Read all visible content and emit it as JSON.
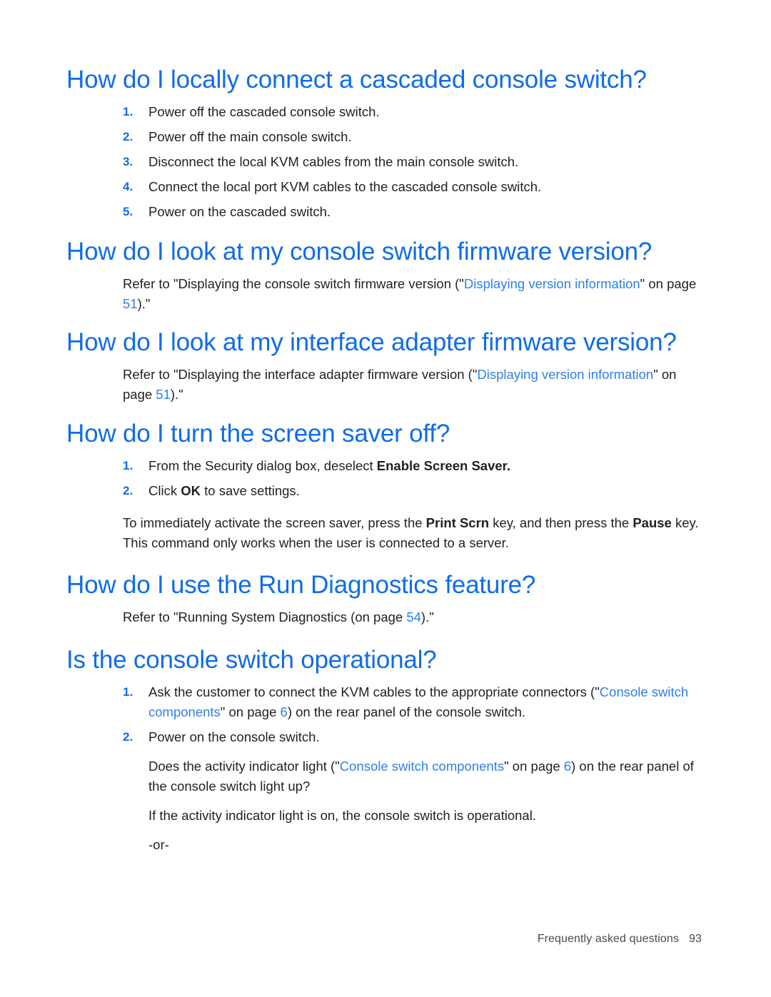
{
  "document": {
    "accent_color": "#0f6ce8",
    "link_color": "#2f7fe8",
    "text_color": "#231f20"
  },
  "sections": [
    {
      "heading": "How do I locally connect a cascaded console switch?",
      "steps": [
        {
          "num": "1.",
          "text": "Power off the cascaded console switch."
        },
        {
          "num": "2.",
          "text": "Power off the main console switch."
        },
        {
          "num": "3.",
          "text": "Disconnect the local KVM cables from the main console switch."
        },
        {
          "num": "4.",
          "text": "Connect the local port KVM cables to the cascaded console switch."
        },
        {
          "num": "5.",
          "text": "Power on the cascaded switch."
        }
      ]
    },
    {
      "heading": "How do I look at my console switch firmware version?",
      "paragraph": {
        "pre": "Refer to \"Displaying the console switch firmware version (\"",
        "link": "Displaying version information",
        "mid": "\" on page ",
        "page": "51",
        "post": ").\""
      }
    },
    {
      "heading": "How do I look at my interface adapter firmware version?",
      "paragraph": {
        "pre": "Refer to \"Displaying the interface adapter firmware version (\"",
        "link": "Displaying version information",
        "mid": "\" on page ",
        "page": "51",
        "post": ").\""
      }
    },
    {
      "heading": "How do I turn the screen saver off?",
      "steps": [
        {
          "num": "1.",
          "pre": "From the Security dialog box, deselect ",
          "bold": "Enable Screen Saver.",
          "post": ""
        },
        {
          "num": "2.",
          "pre": "Click ",
          "bold": "OK",
          "post": " to save settings."
        }
      ],
      "note": {
        "pre": "To immediately activate the screen saver, press the ",
        "bold1": "Print Scrn",
        "mid": " key, and then press the ",
        "bold2": "Pause",
        "post": " key. This command only works when the user is connected to a server."
      }
    },
    {
      "heading": "How do I use the Run Diagnostics feature?",
      "paragraph": {
        "pre": "Refer to \"Running System Diagnostics (on page ",
        "page": "54",
        "post": ").\""
      }
    },
    {
      "heading": "Is the console switch operational?",
      "steps": [
        {
          "num": "1.",
          "pre": "Ask the customer to connect the KVM cables to the appropriate connectors (\"",
          "link": "Console switch components",
          "mid": "\" on page ",
          "page": "6",
          "post": ") on the rear panel of the console switch."
        },
        {
          "num": "2.",
          "text": "Power on the console switch.",
          "sub_paragraphs": [
            {
              "pre": "Does the activity indicator light (\"",
              "link": "Console switch components",
              "mid": "\" on page ",
              "page": "6",
              "post": ") on the rear panel of the console switch light up?"
            },
            {
              "pre": "If the activity indicator light is on, the console switch is operational.",
              "link": "",
              "mid": "",
              "page": "",
              "post": ""
            },
            {
              "pre": "-or-",
              "link": "",
              "mid": "",
              "page": "",
              "post": ""
            }
          ]
        }
      ]
    }
  ],
  "footer": {
    "chapter": "Frequently asked questions",
    "page": "93"
  }
}
